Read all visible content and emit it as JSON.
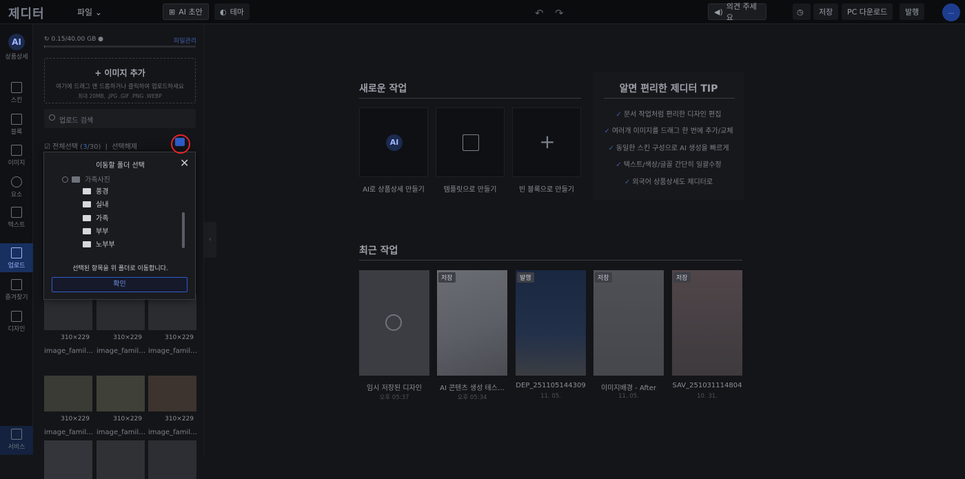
{
  "app": {
    "logo": "제디터",
    "file_menu": "파일"
  },
  "toolbar": {
    "ai_draft": "AI 초안",
    "theme": "테마",
    "feedback": "의견 주세요",
    "save": "저장",
    "pc_download": "PC 다운로드",
    "publish": "발행",
    "avatar": "..."
  },
  "rail": [
    {
      "label": "상품상세",
      "icon": "ai-icon"
    },
    {
      "label": "스킨",
      "icon": "skin-icon"
    },
    {
      "label": "블록",
      "icon": "block-icon"
    },
    {
      "label": "이미지",
      "icon": "image-icon"
    },
    {
      "label": "요소",
      "icon": "element-icon"
    },
    {
      "label": "텍스트",
      "icon": "text-icon"
    },
    {
      "label": "업로드",
      "icon": "upload-icon",
      "active": true
    },
    {
      "label": "즐겨찾기",
      "icon": "bookmark-icon"
    },
    {
      "label": "디자인",
      "icon": "my-design-icon"
    },
    {
      "label": "서비스",
      "icon": "service-icon"
    }
  ],
  "upload_panel": {
    "storage_text": "0.15/40.00 GB",
    "storage_used_fraction": 0.004,
    "file_manage": "파일관리",
    "add_image": "+ 이미지 추가",
    "drop_desc": "여기에 드래그 앤 드롭하거나 클릭하여 업로드하세요",
    "drop_limits": "최대 20MB, .JPG .GIF .PNG .WEBP",
    "search_placeholder": "업로드 검색",
    "select_all": "전체선택",
    "selected_count": "3",
    "total_count": "/30)",
    "deselect": "선택해제"
  },
  "thumbnails": [
    {
      "size": "310×229",
      "name": "image_famil…"
    },
    {
      "size": "310×229",
      "name": "image_famil…"
    },
    {
      "size": "310×229",
      "name": "image_famil…"
    },
    {
      "size": "310×229",
      "name": "image_famil…"
    },
    {
      "size": "310×229",
      "name": "image_famil…"
    },
    {
      "size": "310×229",
      "name": "image_famil…"
    }
  ],
  "move_modal": {
    "title": "이동할 폴더 선택",
    "root_folder": "가족사진",
    "folders": [
      "풍경",
      "실내",
      "가족",
      "부부",
      "노부부"
    ],
    "message": "선택된 항목을 위 폴더로 이동합니다.",
    "confirm": "확인"
  },
  "new_work": {
    "title": "새로운 작업",
    "cards": [
      {
        "label": "AI로 상품상세 만들기",
        "icon": "ai-icon"
      },
      {
        "label": "템플릿으로 만들기",
        "icon": "template-icon"
      },
      {
        "label": "빈 블록으로 만들기",
        "icon": "plus-icon"
      }
    ]
  },
  "tips": {
    "title": "알면 편리한 제디터 TIP",
    "items": [
      "문서 작업처럼 편리한 디자인 편집",
      "여러개 이미지를 드래그 한 번에 추가/교체",
      "동일한 스킨 구성으로 AI 생성을 빠르게",
      "텍스트/색상/글꼴 간단히 일괄수정",
      "외국어 상품상세도 제디터로"
    ]
  },
  "recent": {
    "title": "최근 작업",
    "items": [
      {
        "badge": "",
        "name": "임시 저장된 디자인",
        "date": "오후 05:37"
      },
      {
        "badge": "저장",
        "name": "AI 콘텐츠 생성 테스…",
        "date": "오후 05:34"
      },
      {
        "badge": "발행",
        "name": "DEP_251105144309",
        "date": "11. 05."
      },
      {
        "badge": "저장",
        "name": "이미지배경 - After",
        "date": "11. 05."
      },
      {
        "badge": "저장",
        "name": "SAV_251031114804",
        "date": "10. 31."
      }
    ]
  }
}
